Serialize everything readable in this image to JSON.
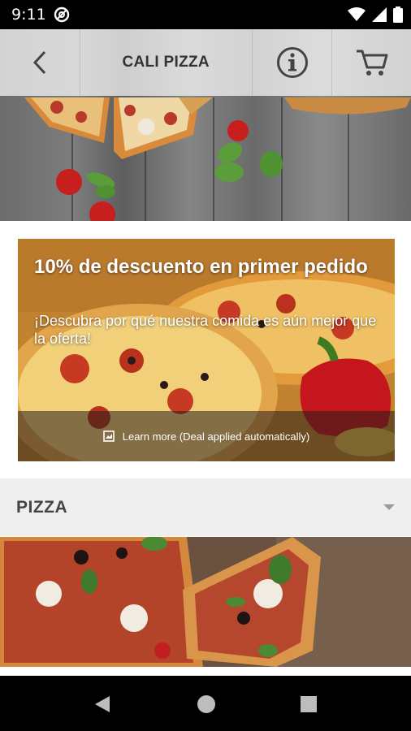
{
  "status_bar": {
    "time": "9:11",
    "icons": [
      "at-sign-icon",
      "wifi-icon",
      "signal-icon",
      "battery-icon"
    ]
  },
  "app_bar": {
    "title": "CALI PIZZA",
    "back_icon": "back-arrow-icon",
    "info_icon": "info-icon",
    "cart_icon": "cart-icon"
  },
  "promo": {
    "title": "10% de descuento en primer pedido",
    "subtitle": "¡Descubra por qué nuestra comida es aún mejor que la oferta!",
    "footer_label": "Learn more (Deal applied automatically)",
    "footer_icon": "image-icon"
  },
  "section": {
    "title": "PIZZA",
    "expand_icon": "dropdown-arrow-icon"
  },
  "nav": {
    "icons": [
      "nav-back-icon",
      "nav-home-icon",
      "nav-recent-icon"
    ]
  },
  "colors": {
    "app_bar_text": "#333333",
    "section_bg": "#efefef",
    "section_text": "#444444"
  }
}
